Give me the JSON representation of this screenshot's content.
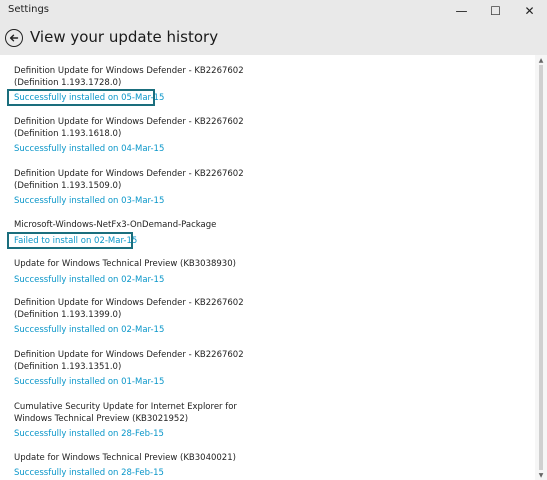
{
  "window": {
    "title": "Settings",
    "minimize_glyph": "—",
    "maximize_glyph": "☐",
    "close_glyph": "✕"
  },
  "header": {
    "back_icon": "back-arrow-icon",
    "title": "View your update history"
  },
  "colors": {
    "status_text": "#0a96c9",
    "highlight_border": "#1a6e7d",
    "chrome_bg": "#e9e9e9"
  },
  "updates": [
    {
      "name": "Definition Update for Windows Defender - KB2267602 (Definition 1.193.1728.0)",
      "status": "Successfully installed on 05-Mar-15",
      "highlighted": true
    },
    {
      "name": "Definition Update for Windows Defender - KB2267602 (Definition 1.193.1618.0)",
      "status": "Successfully installed on 04-Mar-15",
      "highlighted": false
    },
    {
      "name": "Definition Update for Windows Defender - KB2267602 (Definition 1.193.1509.0)",
      "status": "Successfully installed on 03-Mar-15",
      "highlighted": false
    },
    {
      "name": "Microsoft-Windows-NetFx3-OnDemand-Package",
      "status": "Failed to install on 02-Mar-15",
      "highlighted": true
    },
    {
      "name": "Update for Windows Technical Preview (KB3038930)",
      "status": "Successfully installed on 02-Mar-15",
      "highlighted": false
    },
    {
      "name": "Definition Update for Windows Defender - KB2267602 (Definition 1.193.1399.0)",
      "status": "Successfully installed on 02-Mar-15",
      "highlighted": false
    },
    {
      "name": "Definition Update for Windows Defender - KB2267602 (Definition 1.193.1351.0)",
      "status": "Successfully installed on 01-Mar-15",
      "highlighted": false
    },
    {
      "name": "Cumulative Security Update for Internet Explorer for Windows Technical Preview (KB3021952)",
      "status": "Successfully installed on 28-Feb-15",
      "highlighted": false
    },
    {
      "name": "Update for Windows Technical Preview (KB3040021)",
      "status": "Successfully installed on 28-Feb-15",
      "highlighted": false
    }
  ]
}
